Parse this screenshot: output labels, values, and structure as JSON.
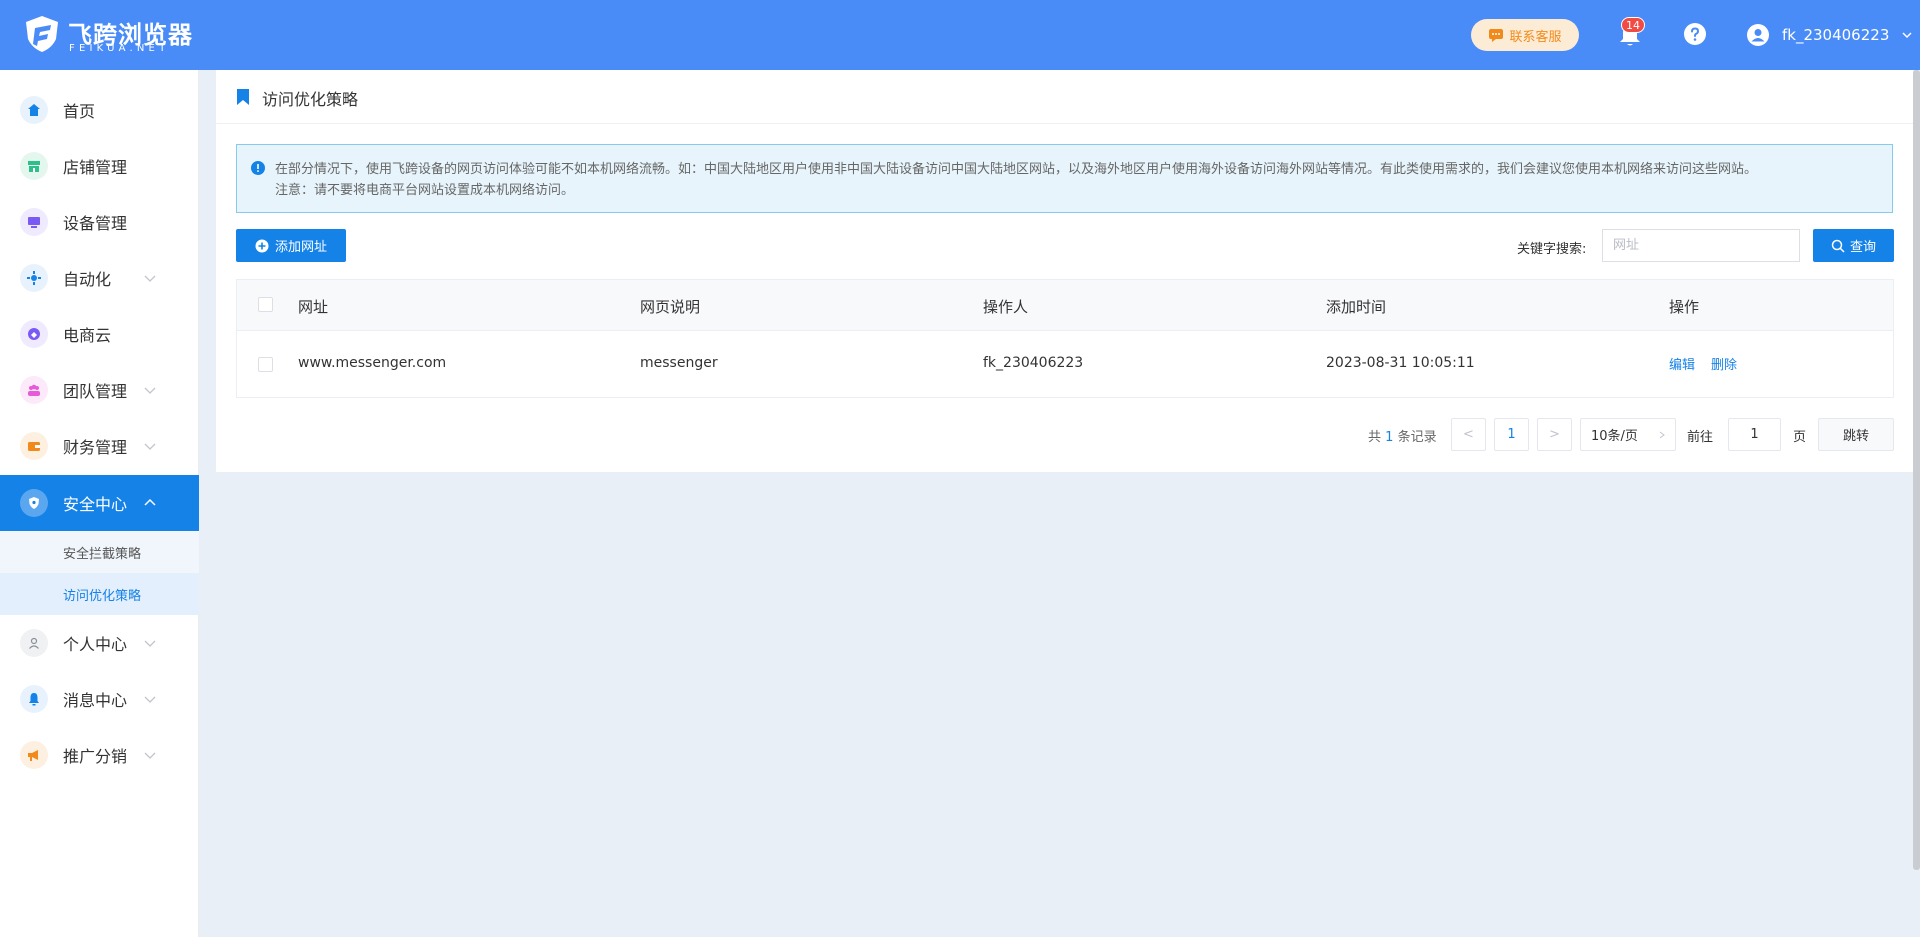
{
  "header": {
    "brand_title": "飞跨浏览器",
    "brand_subtitle": "FEIKUA.NET",
    "service_label": "联系客服",
    "notification_count": "14",
    "username": "fk_230406223"
  },
  "sidebar": {
    "items": [
      {
        "label": "首页",
        "icon": "home-icon",
        "color": "#1582e8"
      },
      {
        "label": "店铺管理",
        "icon": "store-icon",
        "color": "#2fbf8f"
      },
      {
        "label": "设备管理",
        "icon": "device-icon",
        "color": "#7a5af5"
      },
      {
        "label": "自动化",
        "icon": "automation-icon",
        "color": "#1582e8"
      },
      {
        "label": "电商云",
        "icon": "cloud-icon",
        "color": "#7a5af5"
      },
      {
        "label": "团队管理",
        "icon": "team-icon",
        "color": "#e55bd8"
      },
      {
        "label": "财务管理",
        "icon": "wallet-icon",
        "color": "#f28a1b"
      },
      {
        "label": "安全中心",
        "icon": "shield-icon",
        "color": "#1582e8"
      },
      {
        "label": "个人中心",
        "icon": "person-icon",
        "color": "#8a8f99"
      },
      {
        "label": "消息中心",
        "icon": "bell-icon",
        "color": "#1582e8"
      },
      {
        "label": "推广分销",
        "icon": "megaphone-icon",
        "color": "#f28a1b"
      }
    ],
    "sub_items": [
      {
        "label": "安全拦截策略"
      },
      {
        "label": "访问优化策略"
      }
    ]
  },
  "main": {
    "page_title": "访问优化策略",
    "notice_line1": "在部分情况下，使用飞跨设备的网页访问体验可能不如本机网络流畅。如：中国大陆地区用户使用非中国大陆设备访问中国大陆地区网站，以及海外地区用户使用海外设备访问海外网站等情况。有此类使用需求的，我们会建议您使用本机网络来访问这些网站。",
    "notice_line2": "注意：请不要将电商平台网站设置成本机网络访问。",
    "add_button": "添加网址",
    "keyword_label": "关键字搜索:",
    "search_placeholder": "网址",
    "query_button": "查询",
    "table": {
      "columns": [
        "网址",
        "网页说明",
        "操作人",
        "添加时间",
        "操作"
      ],
      "rows": [
        {
          "url": "www.messenger.com",
          "desc": "messenger",
          "operator": "fk_230406223",
          "time": "2023-08-31 10:05:11",
          "edit": "编辑",
          "delete": "删除"
        }
      ]
    },
    "pagination": {
      "total_prefix": "共",
      "total_count": "1",
      "total_suffix": "条记录",
      "prev": "<",
      "current_page": "1",
      "next": ">",
      "page_size": "10条/页",
      "goto_label": "前往",
      "goto_value": "1",
      "page_unit": "页",
      "jump_button": "跳转"
    }
  }
}
